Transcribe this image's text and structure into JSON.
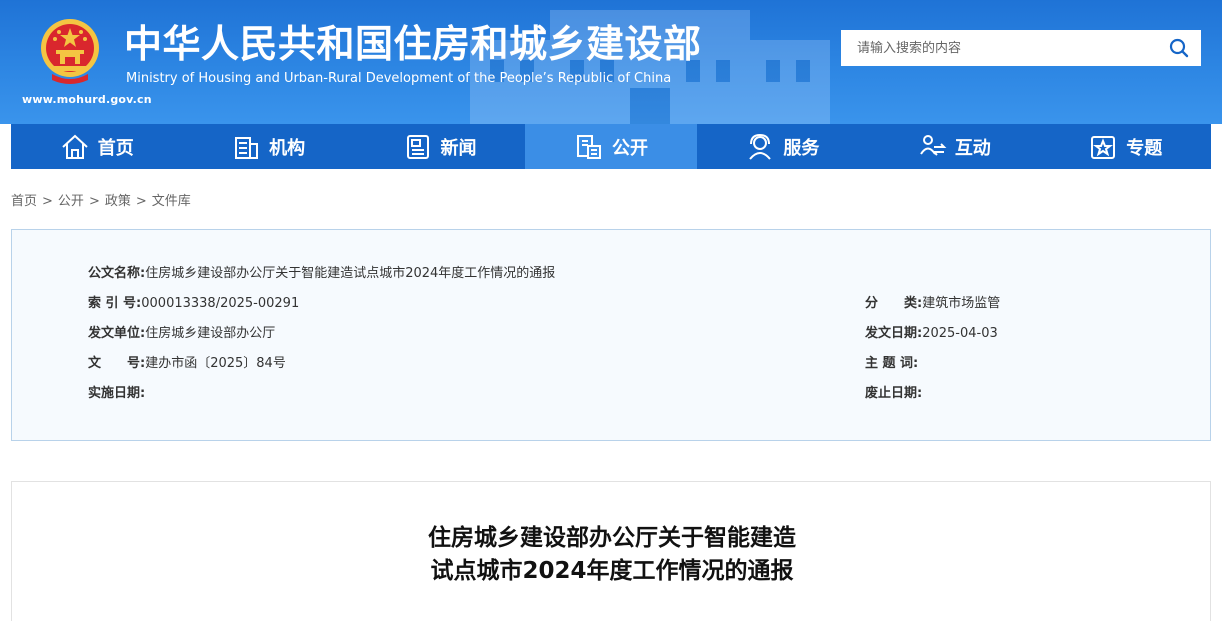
{
  "header": {
    "title_cn": "中华人民共和国住房和城乡建设部",
    "title_en": "Ministry of Housing and Urban-Rural Development of the People’s Republic of China",
    "domain": "www.mohurd.gov.cn",
    "search": {
      "placeholder": "请输入搜索的内容"
    }
  },
  "nav": {
    "items": [
      {
        "label": "首页",
        "icon": "home-icon"
      },
      {
        "label": "机构",
        "icon": "building-icon"
      },
      {
        "label": "新闻",
        "icon": "news-icon"
      },
      {
        "label": "公开",
        "icon": "public-icon",
        "active": true
      },
      {
        "label": "服务",
        "icon": "service-icon"
      },
      {
        "label": "互动",
        "icon": "interaction-icon"
      },
      {
        "label": "专题",
        "icon": "topic-icon"
      }
    ]
  },
  "breadcrumb": [
    "首页",
    "公开",
    "政策",
    "文件库"
  ],
  "meta": {
    "doc_name_label": "公文名称:",
    "doc_name": "住房城乡建设部办公厅关于智能建造试点城市2024年度工作情况的通报",
    "index_label": "索 引 号:",
    "index": "000013338/2025-00291",
    "category_label": "分　　类:",
    "category": "建筑市场监管",
    "issuer_label": "发文单位:",
    "issuer": "住房城乡建设部办公厅",
    "date_label": "发文日期:",
    "date": "2025-04-03",
    "doc_no_label": "文　　号:",
    "doc_no": "建办市函〔2025〕84号",
    "keywords_label": "主 题 词:",
    "keywords": "",
    "effective_label": "实施日期:",
    "effective": "",
    "expire_label": "废止日期:",
    "expire": ""
  },
  "article": {
    "title_line1": "住房城乡建设部办公厅关于智能建造",
    "title_line2": "试点城市2024年度工作情况的通报"
  },
  "colors": {
    "header_blue": "#2d86e3",
    "nav_blue": "#1565c7",
    "nav_active": "#3b8ee6",
    "panel_bg": "#f6fafe",
    "panel_border": "#b8d2ea"
  }
}
